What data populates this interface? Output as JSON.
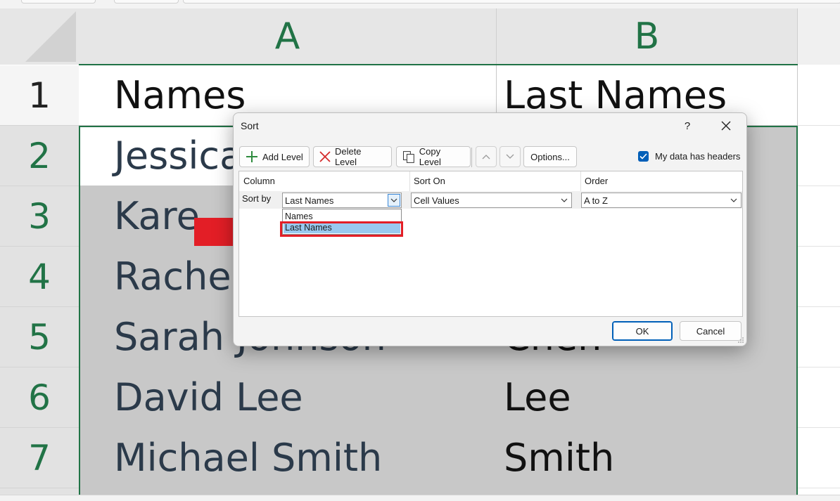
{
  "sheet": {
    "columns": [
      "A",
      "B"
    ],
    "rows": [
      {
        "num": "1",
        "a": "Names",
        "b": "Last Names"
      },
      {
        "num": "2",
        "a": "Jessica",
        "b": ""
      },
      {
        "num": "3",
        "a": "Kare",
        "b": ""
      },
      {
        "num": "4",
        "a": "Rachel",
        "b": ""
      },
      {
        "num": "5",
        "a": "Sarah Johnson",
        "b": "Chen"
      },
      {
        "num": "6",
        "a": "David Lee",
        "b": "Lee"
      },
      {
        "num": "7",
        "a": "Michael Smith",
        "b": "Smith"
      }
    ],
    "colors": {
      "accent": "#217346",
      "selection_fill": "#c8c8c8"
    }
  },
  "dialog": {
    "title": "Sort",
    "help": "?",
    "toolbar": {
      "add_level": "Add Level",
      "delete_level": "Delete Level",
      "copy_level": "Copy Level",
      "options": "Options...",
      "headers_checkbox": "My data has headers",
      "headers_checked": true
    },
    "grid": {
      "headers": {
        "column": "Column",
        "sort_on": "Sort On",
        "order": "Order"
      },
      "row": {
        "label": "Sort by",
        "column_value": "Last Names",
        "sort_on_value": "Cell Values",
        "order_value": "A to Z"
      },
      "dropdown_options": [
        "Names",
        "Last Names"
      ],
      "dropdown_selected": "Last Names"
    },
    "ok": "OK",
    "cancel": "Cancel"
  },
  "annotation": {
    "arrow_color": "#e31e26",
    "highlight_color": "#e31e26"
  }
}
